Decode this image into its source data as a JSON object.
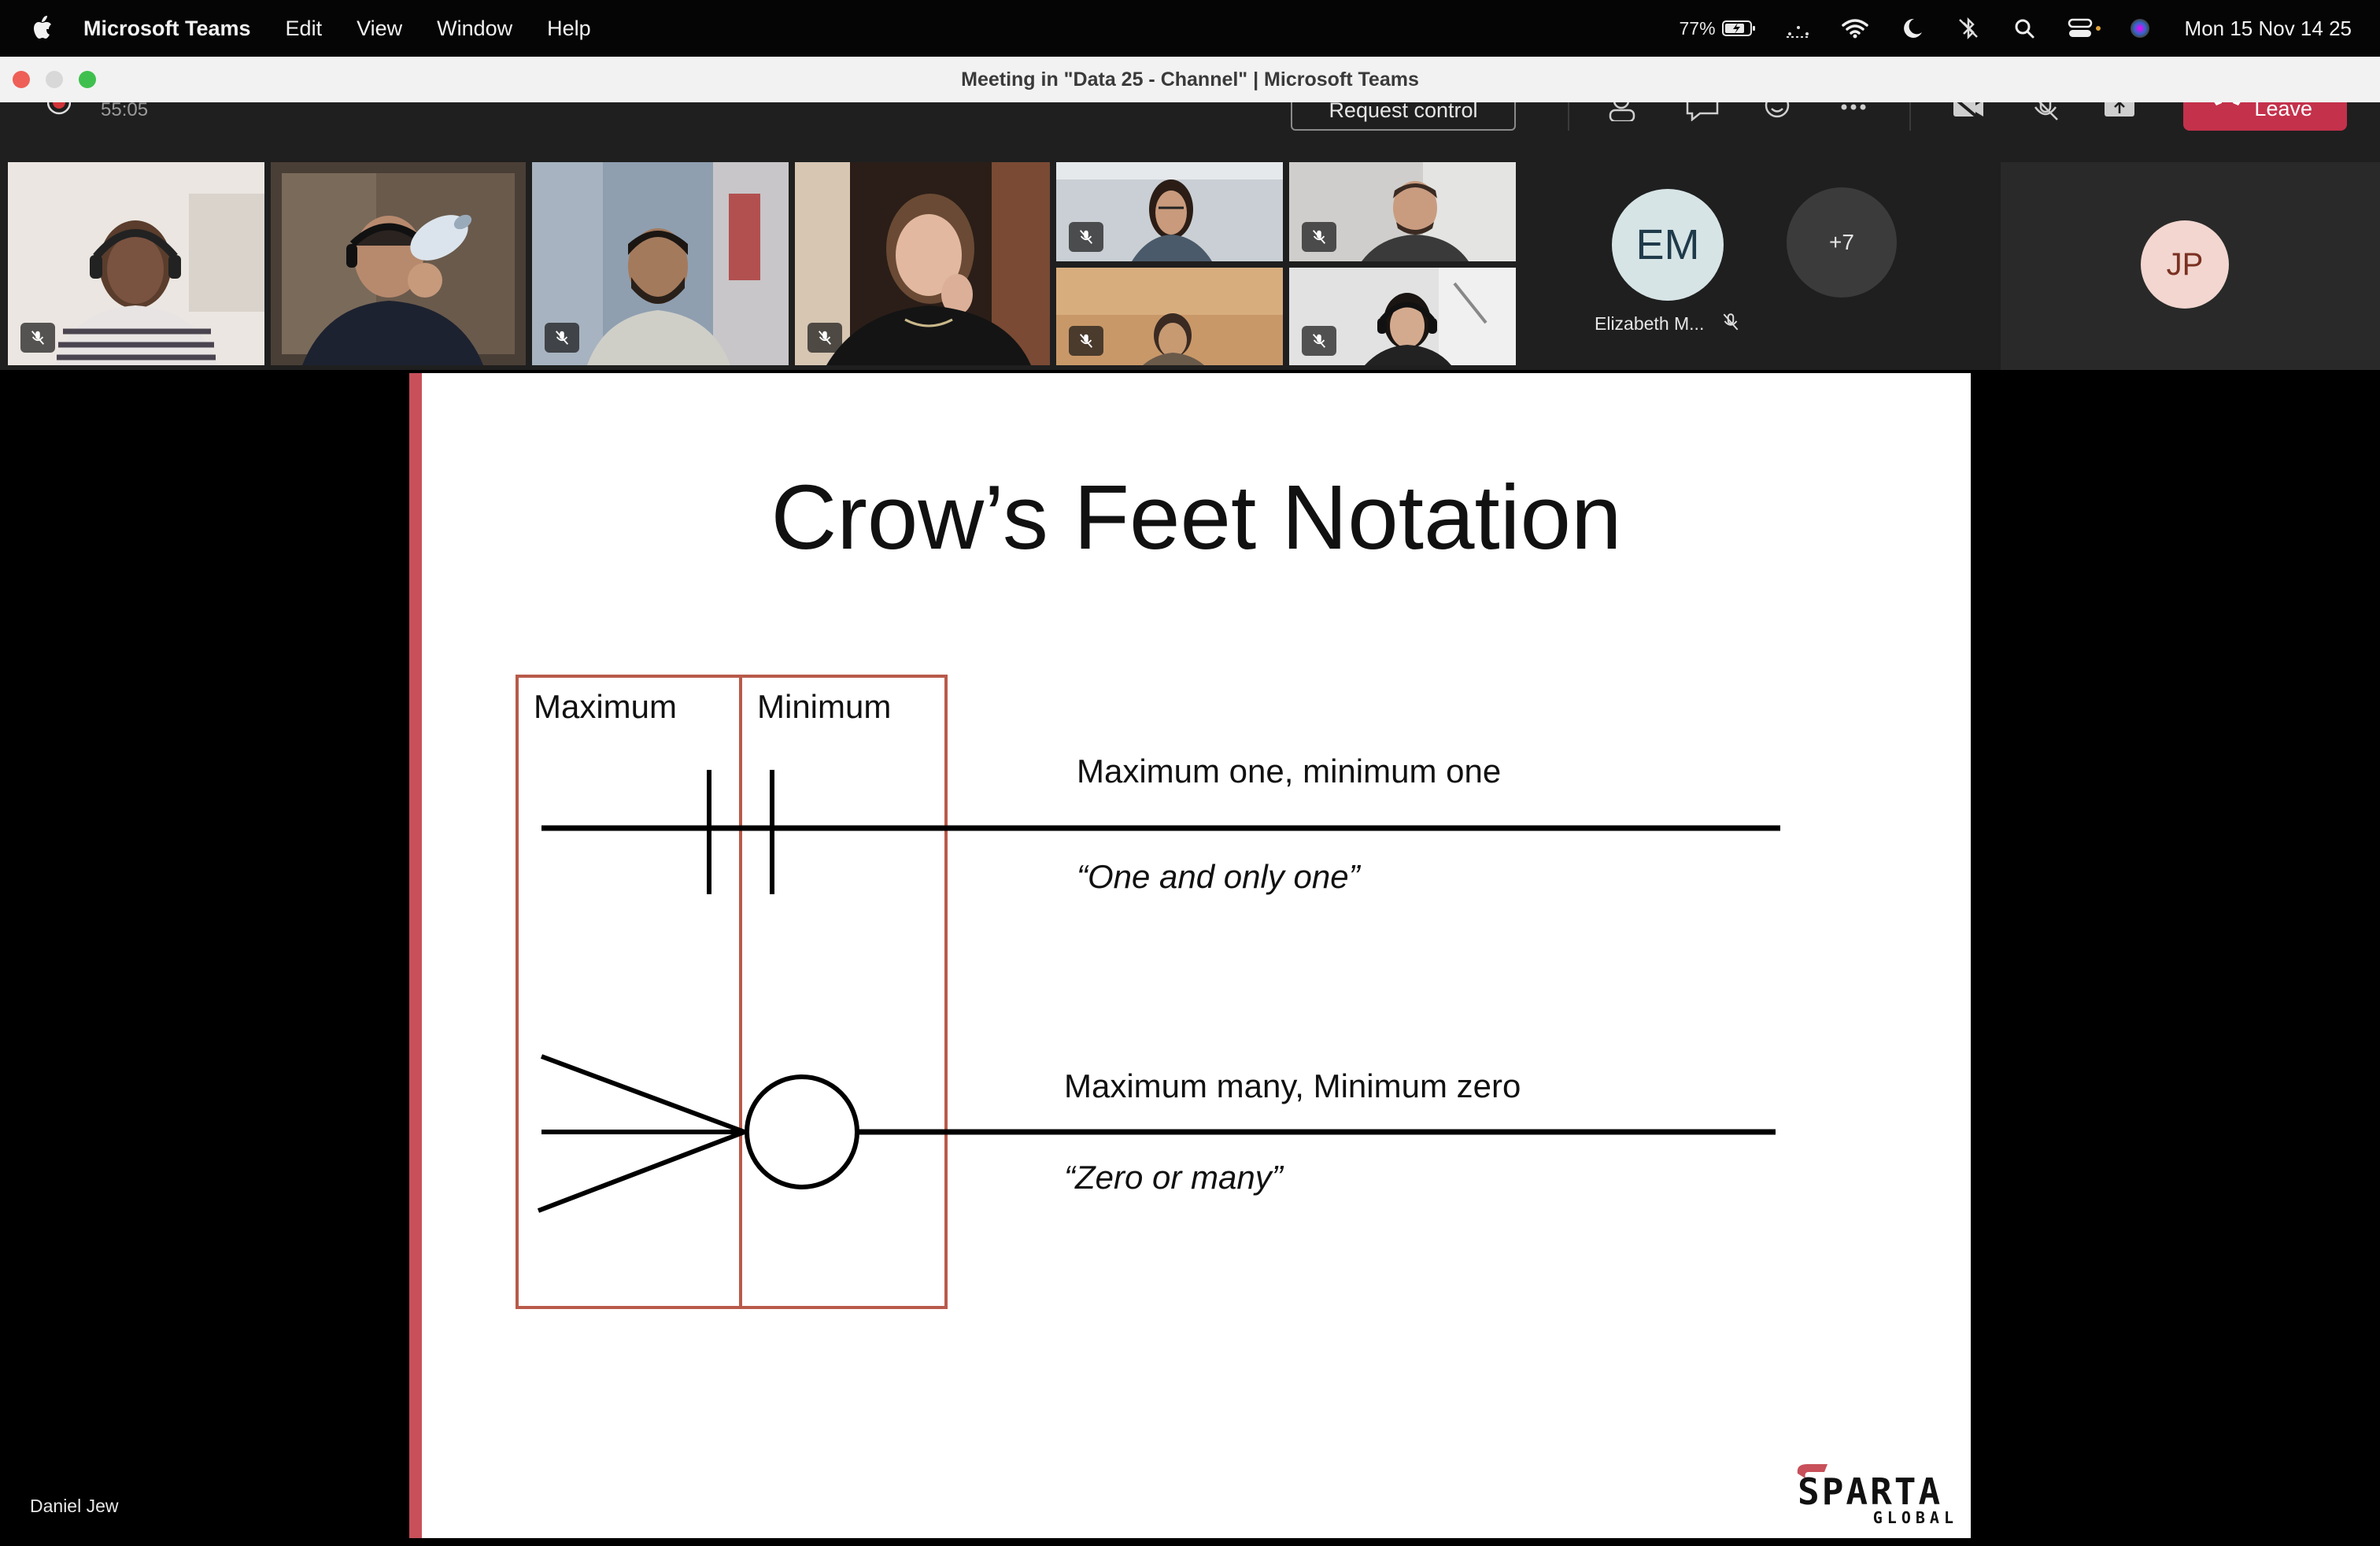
{
  "menubar": {
    "app_name": "Microsoft Teams",
    "menus": [
      "Edit",
      "View",
      "Window",
      "Help"
    ],
    "battery": "77%",
    "clock": "Mon 15 Nov  14 25"
  },
  "window": {
    "title": "Meeting in \"Data 25 - Channel\" | Microsoft Teams"
  },
  "toolbar": {
    "timer": "55:05",
    "request_control_label": "Request control",
    "leave_label": "Leave",
    "leave_color": "#c4314b"
  },
  "participants": {
    "em_initials": "EM",
    "em_name": "Elizabeth M...",
    "overflow_count": "+7",
    "jp_initials": "JP"
  },
  "stage": {
    "presenter_name": "Daniel Jew"
  },
  "slide": {
    "title": "Crow’s Feet Notation",
    "col_max": "Maximum",
    "col_min": "Minimum",
    "row1_desc": "Maximum one, minimum one",
    "row1_quote": "“One and only one”",
    "row2_desc": "Maximum many, Minimum zero",
    "row2_quote": "“Zero or many”",
    "logo_main": "SPARTA",
    "logo_sub": "GLOBAL",
    "accent_color": "#c8505a",
    "box_color": "#b85a4a"
  }
}
